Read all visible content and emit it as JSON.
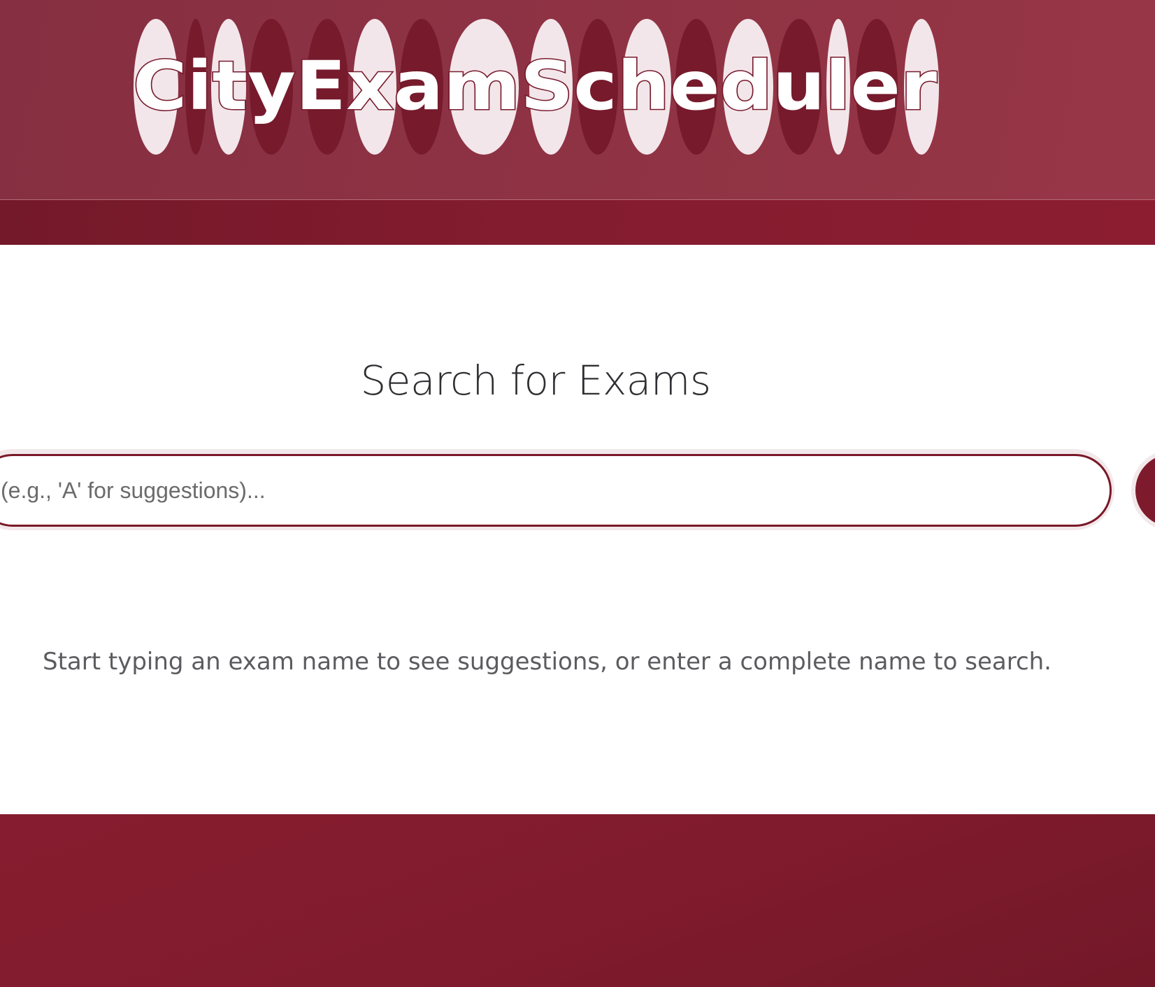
{
  "header": {
    "logo_text": "CityExamScheduler"
  },
  "main": {
    "title": "Search for Exams",
    "search": {
      "placeholder": "(e.g., 'A' for suggestions)...",
      "value": ""
    },
    "hint": "Start typing an exam name to see suggestions, or enter a complete name to search."
  },
  "colors": {
    "header_bg": "#8f3344",
    "accent": "#7a1828",
    "nav_band": "#841c2f",
    "footer_bg": "#801b2d",
    "logo_pill_light": "#f3e6ea",
    "logo_pill_dark": "#761a2c"
  },
  "icons": {
    "search_button": "search-icon"
  }
}
